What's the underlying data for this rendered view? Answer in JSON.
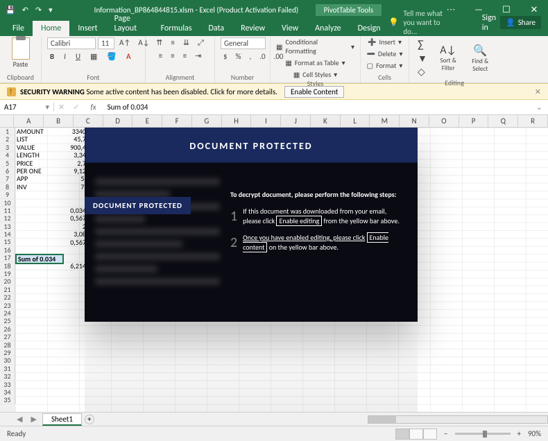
{
  "titlebar": {
    "filename": "Information_BP864844815.xlsm - Excel (Product Activation Failed)",
    "pivot_tools": "PivotTable Tools",
    "save_icon": "💾",
    "undo_icon": "↶",
    "redo_icon": "↷"
  },
  "menu": {
    "tabs": [
      "File",
      "Home",
      "Insert",
      "Page Layout",
      "Formulas",
      "Data",
      "Review",
      "View",
      "Analyze",
      "Design"
    ],
    "tellme": "Tell me what you want to do...",
    "signin": "Sign in",
    "share": "Share"
  },
  "ribbon": {
    "clipboard": {
      "label": "Clipboard",
      "paste": "Paste"
    },
    "font": {
      "label": "Font",
      "name": "Calibri",
      "size": "11",
      "bold": "B",
      "italic": "I",
      "underline": "U"
    },
    "alignment": {
      "label": "Alignment"
    },
    "number": {
      "label": "Number",
      "format": "General"
    },
    "styles": {
      "label": "Styles",
      "cf": "Conditional Formatting",
      "fat": "Format as Table",
      "cs": "Cell Styles"
    },
    "cells": {
      "label": "Cells",
      "insert": "Insert",
      "delete": "Delete",
      "format": "Format"
    },
    "editing": {
      "label": "Editing",
      "sort": "Sort & Filter",
      "find": "Find & Select"
    }
  },
  "security": {
    "title": "SECURITY WARNING",
    "msg": "Some active content has been disabled. Click for more details.",
    "btn": "Enable Content"
  },
  "formula": {
    "cellref": "A17",
    "fx": "fx",
    "content": "Sum of 0.034"
  },
  "columns": [
    "A",
    "B",
    "C",
    "D",
    "E",
    "F",
    "G",
    "H",
    "I",
    "J",
    "K",
    "L",
    "M",
    "N",
    "O",
    "P",
    "Q",
    "R"
  ],
  "row_numbers": [
    "1",
    "2",
    "3",
    "4",
    "5",
    "6",
    "7",
    "8",
    "9",
    "10",
    "11",
    "12",
    "13",
    "14",
    "15",
    "16",
    "17",
    "18",
    "19",
    "20",
    "21",
    "22",
    "23",
    "24",
    "25",
    "26",
    "27",
    "28",
    "29",
    "30",
    "31",
    "32",
    "33",
    "34",
    "35"
  ],
  "cells": {
    "A1": "AMOUNT",
    "B1": "3340",
    "A2": "LIST",
    "B2": "45,7",
    "A3": "VALUE",
    "B3": "900,4",
    "A4": "LENGTH",
    "B4": "3,34",
    "A5": "PRICE",
    "B5": "2,7",
    "A6": "PER ONE",
    "B6": "9,12",
    "A7": "APP",
    "B7": "5,",
    "A8": "INV",
    "B8": "7,",
    "B11": "0,034",
    "B12": "0,567",
    "B13": "2",
    "B14": "3,08",
    "B15": "0,567",
    "A17": "Sum of 0.034",
    "B18": "6,214"
  },
  "overlay": {
    "title": "DOCUMENT PROTECTED",
    "badge": "DOCUMENT PROTECTED",
    "intro": "To decrypt document, please perform the following steps:",
    "step1a": "If this document was downloaded from your email, please click",
    "step1b": "Enable editing",
    "step1c": "from the yellow bar above.",
    "step2a": "Once you have enabled editing, please click",
    "step2b": "Enable content",
    "step2c": "on the yellow bar above."
  },
  "sheets": {
    "name": "Sheet1"
  },
  "status": {
    "ready": "Ready",
    "zoom": "90%"
  }
}
